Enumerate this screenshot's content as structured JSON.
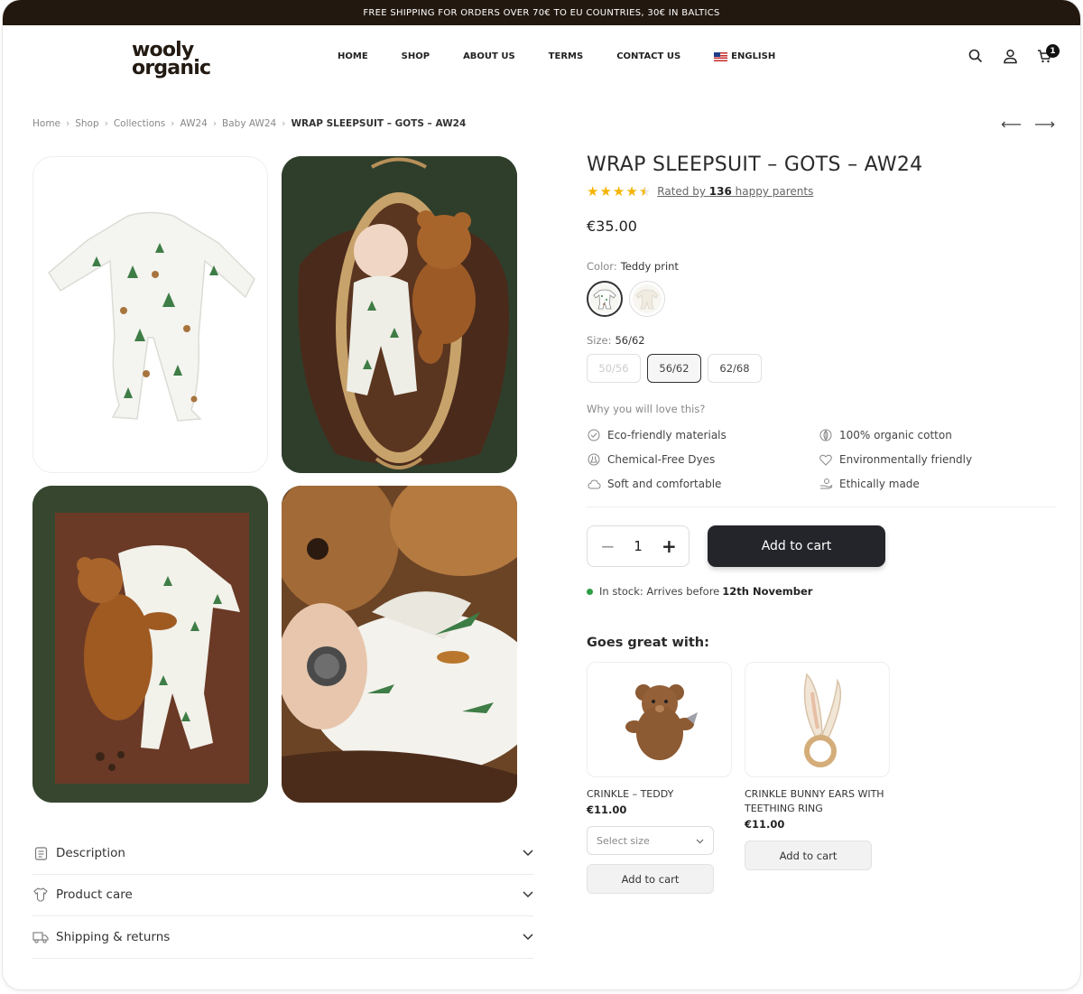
{
  "topbar": {
    "text": "FREE SHIPPING FOR ORDERS OVER 70€ TO EU COUNTRIES, 30€ IN BALTICS"
  },
  "header": {
    "logo_line1": "wooly",
    "logo_line2": "organic",
    "nav": [
      "HOME",
      "SHOP",
      "ABOUT US",
      "TERMS",
      "CONTACT US"
    ],
    "language": "ENGLISH",
    "cart_count": "1",
    "icons": [
      "search-icon",
      "account-icon",
      "cart-icon"
    ]
  },
  "breadcrumb": {
    "items": [
      "Home",
      "Shop",
      "Collections",
      "AW24",
      "Baby AW24"
    ],
    "current": "WRAP SLEEPSUIT – GOTS – AW24",
    "prev_arrow": "⟵",
    "next_arrow": "⟶"
  },
  "product": {
    "title": "WRAP SLEEPSUIT – GOTS – AW24",
    "rating": 4.5,
    "rating_prefix": "Rated by",
    "rating_count": "136",
    "rating_suffix": "happy parents",
    "price": "€35.00",
    "color_label": "Color:",
    "color_value": "Teddy print",
    "size_label": "Size:",
    "size_value": "56/62",
    "sizes": [
      "50/56",
      "56/62",
      "62/68"
    ],
    "why_label": "Why you will love this?",
    "features": [
      "Eco-friendly materials",
      "100% organic cotton",
      "Chemical-Free Dyes",
      "Environmentally friendly",
      "Soft and comfortable",
      "Ethically made"
    ],
    "quantity": "1",
    "add_to_cart": "Add to cart",
    "stock_text": "In stock: Arrives before",
    "stock_date": "12th November"
  },
  "accordion": [
    "Description",
    "Product care",
    "Shipping & returns"
  ],
  "goes_with": {
    "title": "Goes great with:",
    "items": [
      {
        "name": "CRINKLE – TEDDY",
        "price": "€11.00",
        "select_placeholder": "Select size",
        "button": "Add to cart"
      },
      {
        "name": "CRINKLE BUNNY EARS WITH TEETHING RING",
        "price": "€11.00",
        "button": "Add to cart"
      }
    ]
  },
  "colors": {
    "topbar": "#23180f",
    "add_to_cart": "#24252b",
    "star": "#f5b400",
    "stock_dot": "#2e9e46"
  }
}
